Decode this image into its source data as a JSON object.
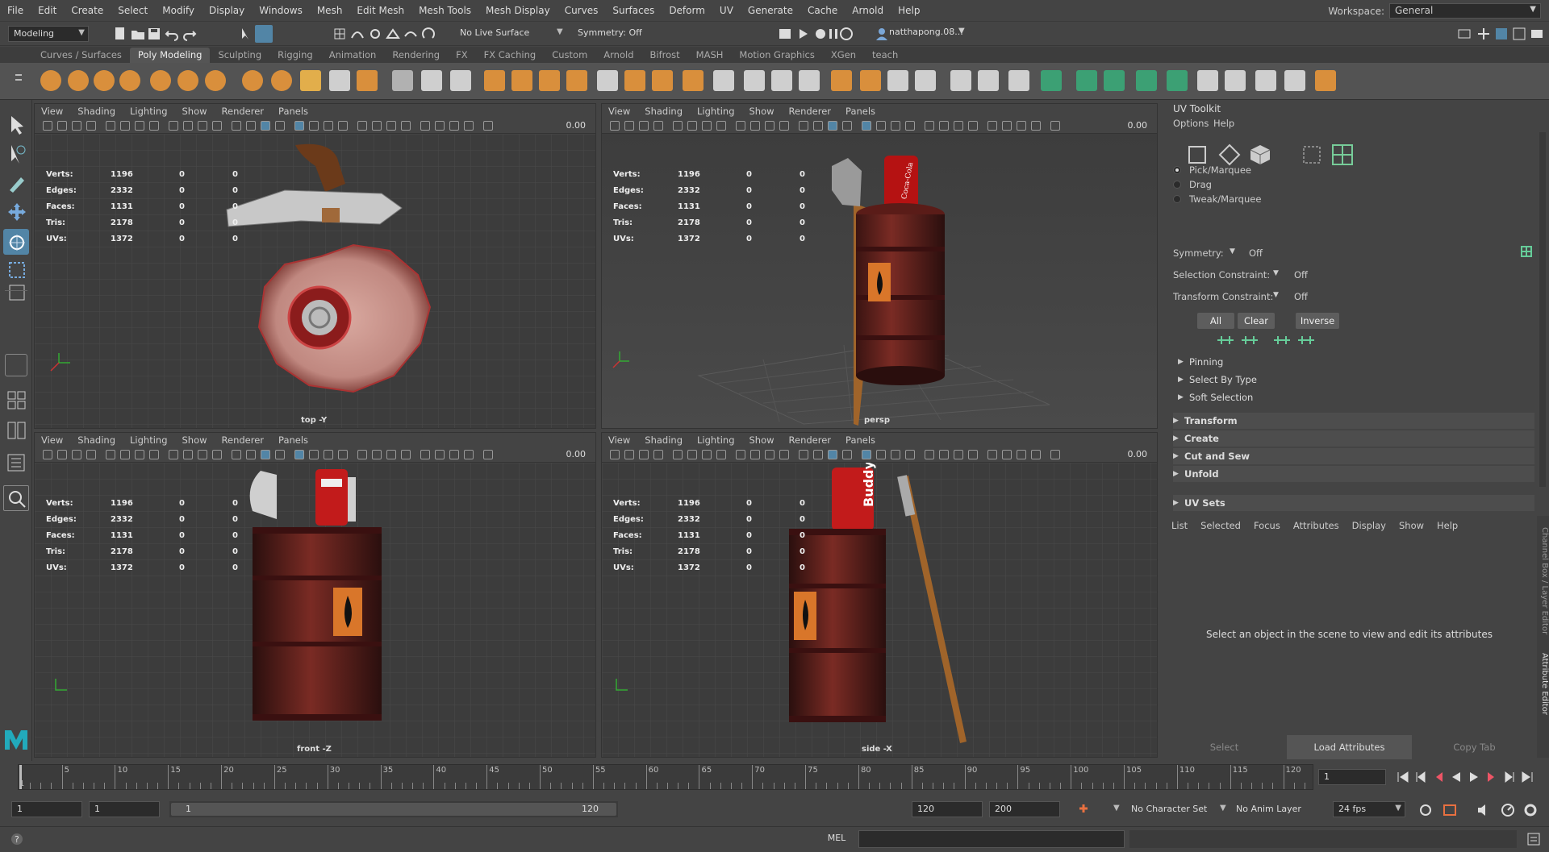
{
  "menu": [
    "File",
    "Edit",
    "Create",
    "Select",
    "Modify",
    "Display",
    "Windows",
    "Mesh",
    "Edit Mesh",
    "Mesh Tools",
    "Mesh Display",
    "Curves",
    "Surfaces",
    "Deform",
    "UV",
    "Generate",
    "Cache",
    "Arnold",
    "Help"
  ],
  "workspace": {
    "label": "Workspace:",
    "value": "General"
  },
  "status": {
    "mode": "Modeling",
    "live_surface": "No Live Surface",
    "symmetry": "Symmetry: Off",
    "user": "natthapong.08..."
  },
  "shelf_tabs": [
    "Curves / Surfaces",
    "Poly Modeling",
    "Sculpting",
    "Rigging",
    "Animation",
    "Rendering",
    "FX",
    "FX Caching",
    "Custom",
    "Arnold",
    "Bifrost",
    "MASH",
    "Motion Graphics",
    "XGen",
    "teach"
  ],
  "shelf_active": "Poly Modeling",
  "panel_menu": [
    "View",
    "Shading",
    "Lighting",
    "Show",
    "Renderer",
    "Panels"
  ],
  "hud_value": "0.00",
  "hud": [
    {
      "k": "Verts:",
      "v": "1196",
      "a": "0",
      "b": "0"
    },
    {
      "k": "Edges:",
      "v": "2332",
      "a": "0",
      "b": "0"
    },
    {
      "k": "Faces:",
      "v": "1131",
      "a": "0",
      "b": "0"
    },
    {
      "k": "Tris:",
      "v": "2178",
      "a": "0",
      "b": "0"
    },
    {
      "k": "UVs:",
      "v": "1372",
      "a": "0",
      "b": "0"
    }
  ],
  "viewports": {
    "top": "top -Y",
    "persp": "persp",
    "front": "front -Z",
    "side": "side -X"
  },
  "can_label": "Buddy",
  "uv_toolkit": {
    "title": "UV Toolkit",
    "menu": [
      "Options",
      "Help"
    ],
    "modes": [
      "Pick/Marquee",
      "Drag",
      "Tweak/Marquee"
    ],
    "symmetry_label": "Symmetry:",
    "symmetry_value": "Off",
    "sel_constraint_label": "Selection Constraint:",
    "sel_constraint_value": "Off",
    "tr_constraint_label": "Transform Constraint:",
    "tr_constraint_value": "Off",
    "buttons": [
      "All",
      "Clear",
      "Inverse"
    ],
    "sub_sections": [
      "Pinning",
      "Select By Type",
      "Soft Selection"
    ],
    "sections": [
      "Transform",
      "Create",
      "Cut and Sew",
      "Unfold"
    ],
    "uv_sets": "UV Sets"
  },
  "attr_editor": {
    "menu": [
      "List",
      "Selected",
      "Focus",
      "Attributes",
      "Display",
      "Show",
      "Help"
    ],
    "message": "Select an object in the scene to view and edit its attributes",
    "buttons": [
      "Select",
      "Load Attributes",
      "Copy Tab"
    ]
  },
  "side_tabs": [
    "Channel Box / Layer Editor",
    "Attribute Editor"
  ],
  "timeline": {
    "ticks": [
      "5",
      "10",
      "15",
      "20",
      "25",
      "30",
      "35",
      "40",
      "45",
      "50",
      "55",
      "60",
      "65",
      "70",
      "75",
      "80",
      "85",
      "90",
      "95",
      "100",
      "105",
      "110",
      "115",
      "120"
    ],
    "start_mark": "1",
    "current_frame": "1"
  },
  "range": {
    "start": "1",
    "inner_start": "1",
    "slider_start": "1",
    "slider_end": "120",
    "end": "120",
    "outer_end": "200",
    "character_set": "No Character Set",
    "anim_layer": "No Anim Layer",
    "fps": "24 fps"
  },
  "cmd": {
    "label": "MEL"
  }
}
